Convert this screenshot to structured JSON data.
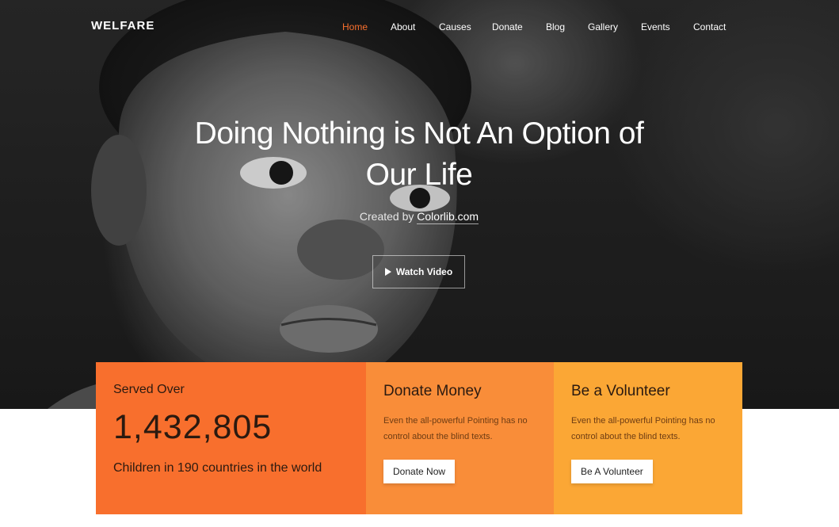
{
  "nav": {
    "logo": "WELFARE",
    "items": [
      "Home",
      "About",
      "Causes",
      "Donate",
      "Blog",
      "Gallery",
      "Events",
      "Contact"
    ],
    "active_item": "Home"
  },
  "hero": {
    "title": "Doing Nothing is Not An Option of Our Life",
    "credit_prefix": "Created by",
    "credit_link": "Colorlib.com",
    "watch_video_label": "Watch Video"
  },
  "stats": {
    "served_label": "Served Over",
    "served_number": "1,432,805",
    "served_sub": "Children in 190 countries in the world"
  },
  "donate": {
    "title": "Donate Money",
    "text": "Even the all-powerful Pointing has no control about the blind texts.",
    "button": "Donate Now"
  },
  "volunteer": {
    "title": "Be a Volunteer",
    "text": "Even the all-powerful Pointing has no control about the blind texts.",
    "button": "Be A Volunteer"
  },
  "colors": {
    "accent": "#f86f2d",
    "card_served": "#f86f2d",
    "card_donate": "#f98d39",
    "card_volunteer": "#fba735"
  },
  "icons": [
    "play-icon"
  ]
}
